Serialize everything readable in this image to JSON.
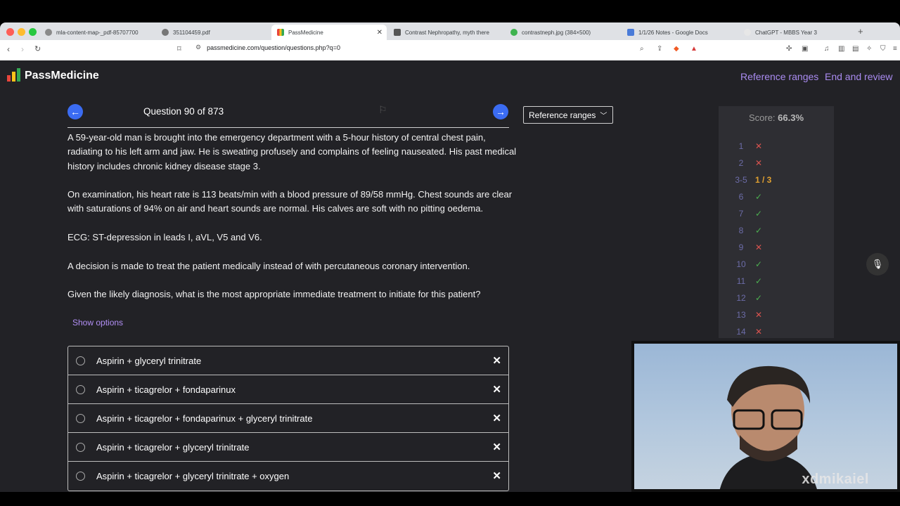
{
  "browser": {
    "tabs": [
      {
        "label": "mla-content-map-_pdf-85707700",
        "color": "#8a8a8a",
        "active": false
      },
      {
        "label": "351104459.pdf",
        "color": "#777777",
        "active": false
      },
      {
        "label": "PassMedicine",
        "color": "#ffc21a",
        "active": true
      },
      {
        "label": "Contrast Nephropathy, myth there",
        "color": "#555555",
        "active": false
      },
      {
        "label": "contrastneph.jpg (384×500)",
        "color": "#3fb34f",
        "active": false
      },
      {
        "label": "1/1/26 Notes - Google Docs",
        "color": "#4a7bd8",
        "active": false
      },
      {
        "label": "ChatGPT - MBBS Year 3",
        "color": "#e7e7e7",
        "active": false
      }
    ],
    "url": "passmedicine.com/question/questions.php?q=0"
  },
  "header": {
    "logo_text": "PassMedicine",
    "reference_ranges_link": "Reference ranges",
    "end_review_link": "End and review"
  },
  "question": {
    "counter": "Question 90 of 873",
    "reference_ranges_button": "Reference ranges",
    "paragraphs": [
      "A 59-year-old man is brought into the emergency department with a 5-hour history of central chest pain, radiating to his left arm and jaw. He is sweating profusely and complains of feeling nauseated. His past medical history includes chronic kidney disease stage 3.",
      "On examination, his heart rate is 113 beats/min with a blood pressure of 89/58 mmHg. Chest sounds are clear with saturations of 94% on air and heart sounds are normal. His calves are soft with no pitting oedema.",
      "ECG: ST-depression in leads I, aVL, V5 and V6.",
      "A decision is made to treat the patient medically instead of with percutaneous coronary intervention.",
      "Given the likely diagnosis, what is the most appropriate immediate treatment to initiate for this patient?"
    ],
    "show_options": "Show options",
    "options": [
      "Aspirin + glyceryl trinitrate",
      "Aspirin + ticagrelor + fondaparinux",
      "Aspirin + ticagrelor + fondaparinux + glyceryl trinitrate",
      "Aspirin + ticagrelor + glyceryl trinitrate",
      "Aspirin + ticagrelor + glyceryl trinitrate + oxygen"
    ]
  },
  "score": {
    "label": "Score: ",
    "value": "66.3%",
    "rows": [
      {
        "num": "1",
        "mark": "✕",
        "color": "#d9534f"
      },
      {
        "num": "2",
        "mark": "✕",
        "color": "#d9534f"
      },
      {
        "num": "3-5",
        "mark": "1 / 3",
        "color": "#e0a030"
      },
      {
        "num": "6",
        "mark": "✓",
        "color": "#4caf50"
      },
      {
        "num": "7",
        "mark": "✓",
        "color": "#4caf50"
      },
      {
        "num": "8",
        "mark": "✓",
        "color": "#4caf50"
      },
      {
        "num": "9",
        "mark": "✕",
        "color": "#d9534f"
      },
      {
        "num": "10",
        "mark": "✓",
        "color": "#4caf50"
      },
      {
        "num": "11",
        "mark": "✓",
        "color": "#4caf50"
      },
      {
        "num": "12",
        "mark": "✓",
        "color": "#4caf50"
      },
      {
        "num": "13",
        "mark": "✕",
        "color": "#d9534f"
      },
      {
        "num": "14",
        "mark": "✕",
        "color": "#d9534f"
      }
    ]
  },
  "webcam": {
    "watermark": "xdmikaiel"
  },
  "colors": {
    "accent": "#a98bf0",
    "nav_blue": "#3b6cf2",
    "page_bg": "#222226"
  }
}
